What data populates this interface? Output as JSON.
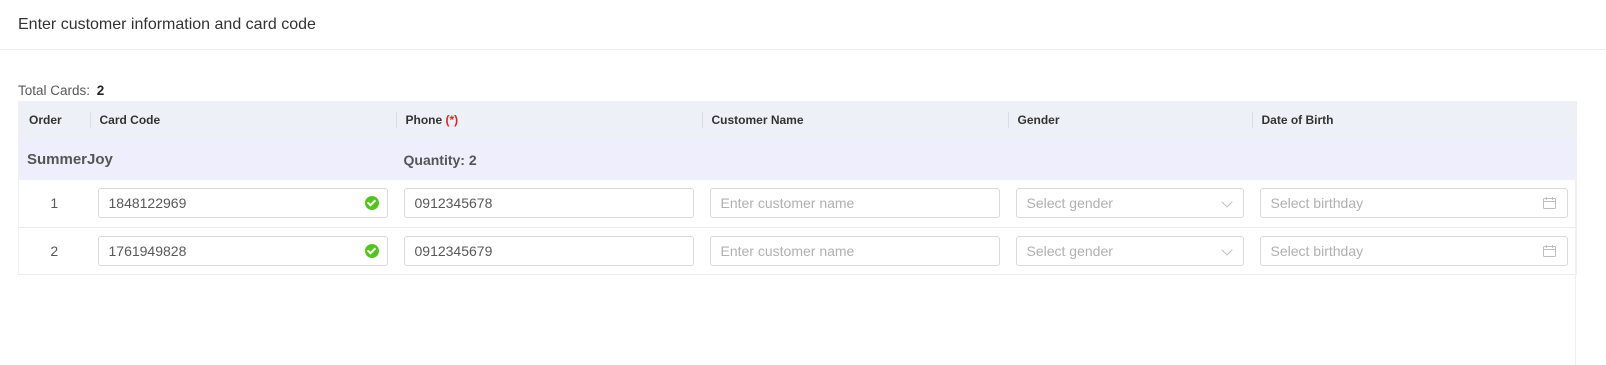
{
  "header": {
    "title": "Enter customer information and card code"
  },
  "summary": {
    "total_label": "Total Cards:",
    "total_value": "2"
  },
  "table": {
    "columns": {
      "order": "Order",
      "card_code": "Card Code",
      "phone": "Phone",
      "phone_required": "(*)",
      "customer_name": "Customer Name",
      "gender": "Gender",
      "dob": "Date of Birth"
    },
    "group": {
      "name": "SummerJoy",
      "quantity_label": "Quantity: 2"
    },
    "rows": [
      {
        "order": "1",
        "card_code": "1848122969",
        "phone": "0912345678",
        "customer_name_placeholder": "Enter customer name",
        "gender_placeholder": "Select gender",
        "dob_placeholder": "Select birthday"
      },
      {
        "order": "2",
        "card_code": "1761949828",
        "phone": "0912345679",
        "customer_name_placeholder": "Enter customer name",
        "gender_placeholder": "Select gender",
        "dob_placeholder": "Select birthday"
      }
    ]
  },
  "icons": {
    "valid": "check-circle-icon",
    "dropdown": "chevron-down-icon",
    "calendar": "calendar-icon"
  },
  "colors": {
    "header_bg": "#edf1f7",
    "group_bg": "#efeefc",
    "valid_green": "#52c41a",
    "required_red": "#e02424"
  }
}
